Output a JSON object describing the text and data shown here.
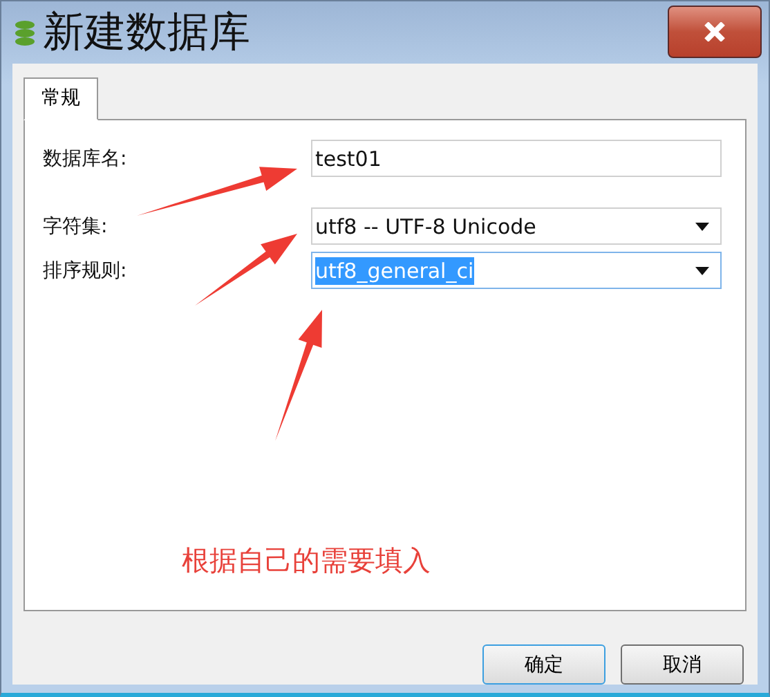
{
  "window": {
    "title": "新建数据库"
  },
  "tabs": [
    {
      "label": "常规",
      "selected": true
    }
  ],
  "fields": [
    {
      "kind": "text",
      "label": "数据库名:",
      "value": "test01",
      "selected": false
    },
    {
      "kind": "select",
      "label": "字符集:",
      "value": "utf8 -- UTF-8 Unicode",
      "selected": false
    },
    {
      "kind": "select",
      "label": "排序规则:",
      "value": "utf8_general_ci",
      "selected": true
    }
  ],
  "annotation": {
    "text": "根据自己的需要填入"
  },
  "buttons": [
    {
      "label": "确定",
      "selected": true
    },
    {
      "label": "取消",
      "selected": false
    }
  ]
}
